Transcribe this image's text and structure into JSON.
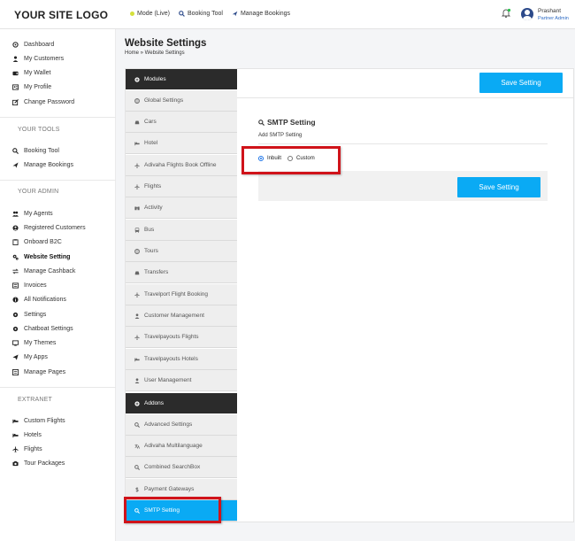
{
  "header": {
    "logo": "YOUR SITE LOGO",
    "nav": [
      {
        "label": "Mode (Live)",
        "icon": "status-dot-icon"
      },
      {
        "label": "Booking Tool",
        "icon": "search-icon"
      },
      {
        "label": "Manage Bookings",
        "icon": "plane-icon"
      }
    ],
    "user": {
      "name": "Prashant",
      "role": "Partner Admin"
    }
  },
  "sidebar": {
    "main": [
      "Dashboard",
      "My Customers",
      "My Wallet",
      "My Profile",
      "Change Password"
    ],
    "tools_header": "YOUR TOOLS",
    "tools": [
      "Booking Tool",
      "Manage Bookings"
    ],
    "admin_header": "YOUR ADMIN",
    "admin": [
      "My Agents",
      "Registered Customers",
      "Onboard B2C",
      "Website Setting",
      "Manage Cashback",
      "Invoices",
      "All Notifications",
      "Settings",
      "Chatboat Settings",
      "My Themes",
      "My Apps",
      "Manage Pages"
    ],
    "extranet_header": "EXTRANET",
    "extranet": [
      "Custom Flights",
      "Hotels",
      "Flights",
      "Tour Packages"
    ]
  },
  "page": {
    "title": "Website Settings",
    "breadcrumb": "Home » Website Settings"
  },
  "settings_menu": {
    "modules_header": "Modules",
    "modules": [
      "Global Settings",
      "Cars",
      "Hotel",
      "Adivaha Flights Book Offline",
      "Flights",
      "Activity",
      "Bus",
      "Tours",
      "Transfers",
      "Travelport Flight Booking",
      "Customer Management",
      "Travelpayouts Flights",
      "Travelpayouts Hotels",
      "User Management"
    ],
    "addons_header": "Addons",
    "addons": [
      "Advanced Settings",
      "Adivaha Multilanguage",
      "Combined SearchBox",
      "Payment Gateways",
      "SMTP Setting"
    ]
  },
  "content": {
    "save_label": "Save Setting",
    "smtp_title": "SMTP Setting",
    "smtp_subtitle": "Add SMTP Setting",
    "radio_inbuilt": "Inbuilt",
    "radio_custom": "Custom",
    "selected": "Inbuilt"
  },
  "colors": {
    "accent": "#0aaaf4",
    "dark": "#2b2b2b",
    "highlight": "#d0131a"
  }
}
